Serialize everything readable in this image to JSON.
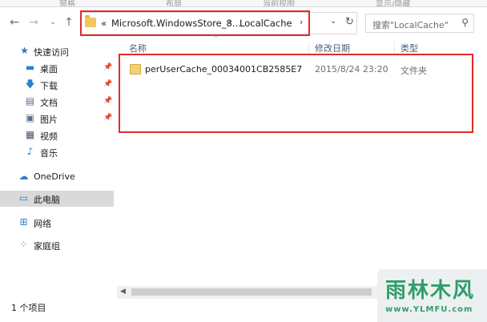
{
  "ribbon": {
    "tabs": [
      "窗格",
      "布局",
      "当前视图",
      "显示/隐藏"
    ]
  },
  "address": {
    "prefix": "«",
    "crumbs": [
      "Microsoft.WindowsStore_8...",
      "LocalCache"
    ],
    "separator": "›"
  },
  "search": {
    "placeholder": "搜索\"LocalCache\""
  },
  "sidebar": {
    "items": [
      {
        "label": "快速访问",
        "icon": "star-icon"
      },
      {
        "label": "桌面",
        "icon": "desktop-icon",
        "pinned": true
      },
      {
        "label": "下载",
        "icon": "download-icon",
        "pinned": true
      },
      {
        "label": "文档",
        "icon": "document-icon",
        "pinned": true
      },
      {
        "label": "图片",
        "icon": "picture-icon",
        "pinned": true
      },
      {
        "label": "视频",
        "icon": "video-icon"
      },
      {
        "label": "音乐",
        "icon": "music-icon"
      },
      {
        "label": "OneDrive",
        "icon": "cloud-icon"
      },
      {
        "label": "此电脑",
        "icon": "computer-icon",
        "selected": true
      },
      {
        "label": "网络",
        "icon": "network-icon"
      },
      {
        "label": "家庭组",
        "icon": "homegroup-icon"
      }
    ]
  },
  "columns": {
    "name": "名称",
    "modified": "修改日期",
    "type": "类型"
  },
  "files": [
    {
      "name": "perUserCache_00034001CB2585E7",
      "modified": "2015/8/24 23:20",
      "type": "文件夹"
    }
  ],
  "status": {
    "count": "1 个项目"
  },
  "watermark": {
    "text": "雨林木风",
    "url": "www.YLMFU.com"
  },
  "colors": {
    "highlight": "#e02b2b",
    "selection": "#d9d9d9",
    "watermark": "#2e9e6a"
  }
}
